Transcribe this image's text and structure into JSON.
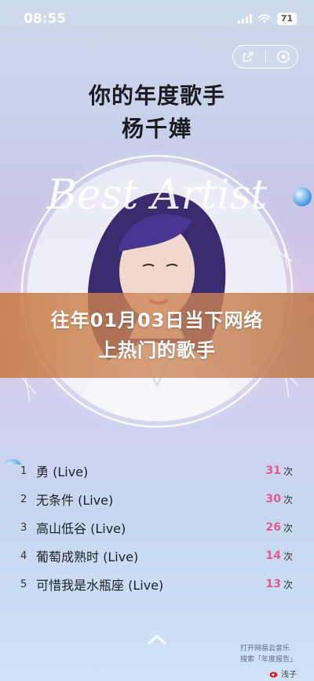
{
  "status": {
    "time": "08:55",
    "battery": "71"
  },
  "header": {
    "heading": "你的年度歌手",
    "artist": "杨千嬅",
    "script_text": "Best Artist"
  },
  "banner": {
    "line1": "往年01月03日当下网络",
    "line2": "上热门的歌手"
  },
  "tracks": [
    {
      "rank": "1",
      "title": "勇 (Live)",
      "count": "31",
      "unit": "次"
    },
    {
      "rank": "2",
      "title": "无条件 (Live)",
      "count": "30",
      "unit": "次"
    },
    {
      "rank": "3",
      "title": "高山低谷 (Live)",
      "count": "26",
      "unit": "次"
    },
    {
      "rank": "4",
      "title": "葡萄成熟时 (Live)",
      "count": "14",
      "unit": "次"
    },
    {
      "rank": "5",
      "title": "可惜我是水瓶座 (Live)",
      "count": "13",
      "unit": "次"
    }
  ],
  "footer": {
    "line1": "打开网易云音乐",
    "line2": "搜索「年度报告」",
    "watermark": "浅子"
  },
  "colors": {
    "accent": "#e25a8a",
    "banner": "#c98257"
  },
  "icons": [
    "signal-icon",
    "wifi-icon",
    "battery-icon",
    "share-icon",
    "more-icon",
    "chevron-up-icon",
    "weibo-icon"
  ]
}
